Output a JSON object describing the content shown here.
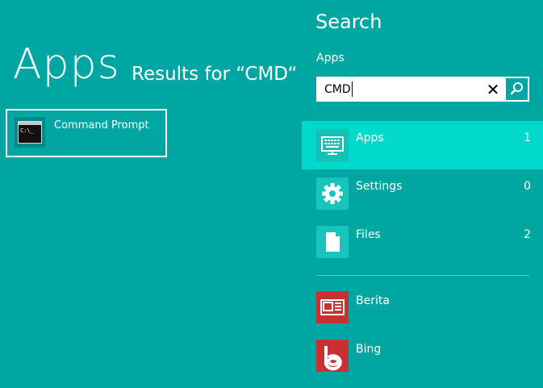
{
  "left": {
    "heading": "Apps",
    "results_text": "Results for “CMD“",
    "results": [
      {
        "label": "Command Prompt",
        "icon": "command-prompt-icon",
        "icon_text": "C:\\_"
      }
    ]
  },
  "search": {
    "title": "Search",
    "scope": "Apps",
    "query": "CMD",
    "clear_icon": "close-icon",
    "go_icon": "search-icon",
    "clear_symbol": "✕"
  },
  "categories": [
    {
      "label": "Apps",
      "count": "1",
      "icon": "keyboard-monitor-icon",
      "selected": true
    },
    {
      "label": "Settings",
      "count": "0",
      "icon": "gear-icon",
      "selected": false
    },
    {
      "label": "Files",
      "count": "2",
      "icon": "document-icon",
      "selected": false
    }
  ],
  "apps": [
    {
      "label": "Berita",
      "icon": "news-icon",
      "color": "#c93034"
    },
    {
      "label": "Bing",
      "icon": "bing-icon",
      "color": "#c93034"
    }
  ],
  "colors": {
    "background": "#00a6a1",
    "selected_row": "#00d9cc",
    "app_tile": "#c93034"
  }
}
